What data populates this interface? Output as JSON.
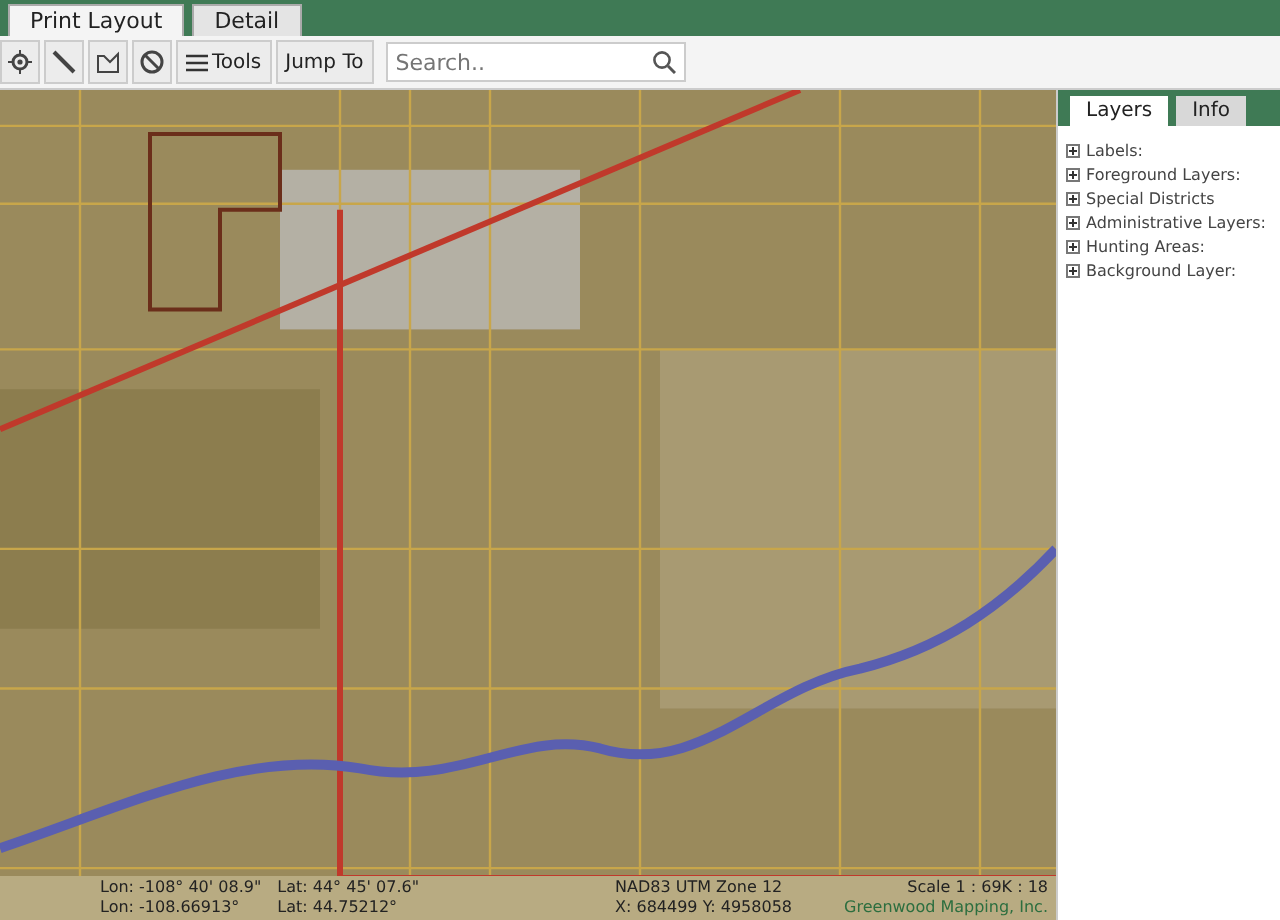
{
  "tabs": [
    {
      "label": "Print Layout",
      "selected": true
    },
    {
      "label": "Detail",
      "selected": false
    }
  ],
  "toolbar": {
    "tools": [
      {
        "kind": "locate"
      },
      {
        "kind": "measure"
      },
      {
        "kind": "area"
      },
      {
        "kind": "clear"
      }
    ],
    "menu_button": "Tools",
    "jump_button": "Jump To",
    "search": {
      "placeholder": "Search.."
    }
  },
  "panel": {
    "tabs": [
      {
        "label": "Layers",
        "selected": true
      },
      {
        "label": "Info",
        "selected": false
      }
    ],
    "layers": [
      {
        "label": "Labels:",
        "expanded": false
      },
      {
        "label": "Foreground Layers:",
        "expanded": false
      },
      {
        "label": "Special Districts",
        "expanded": false
      },
      {
        "label": "Administrative Layers:",
        "expanded": false
      },
      {
        "label": "Hunting Areas:",
        "expanded": false
      },
      {
        "label": "Background Layer:",
        "expanded": false
      }
    ]
  },
  "status_bar": {
    "lon_dms": "Lon: -108° 40' 08.9\"",
    "lat_dms": "Lat: 44° 45' 07.6\"",
    "lon_dec": "Lon: -108.66913°",
    "lat_dec": "Lat: 44.75212°",
    "projection": "NAD83 UTM Zone 12",
    "xy": "X: 684499 Y: 4958058",
    "scale": "Scale 1 : 69K : 18",
    "credit": "Greenwood Mapping, Inc."
  }
}
